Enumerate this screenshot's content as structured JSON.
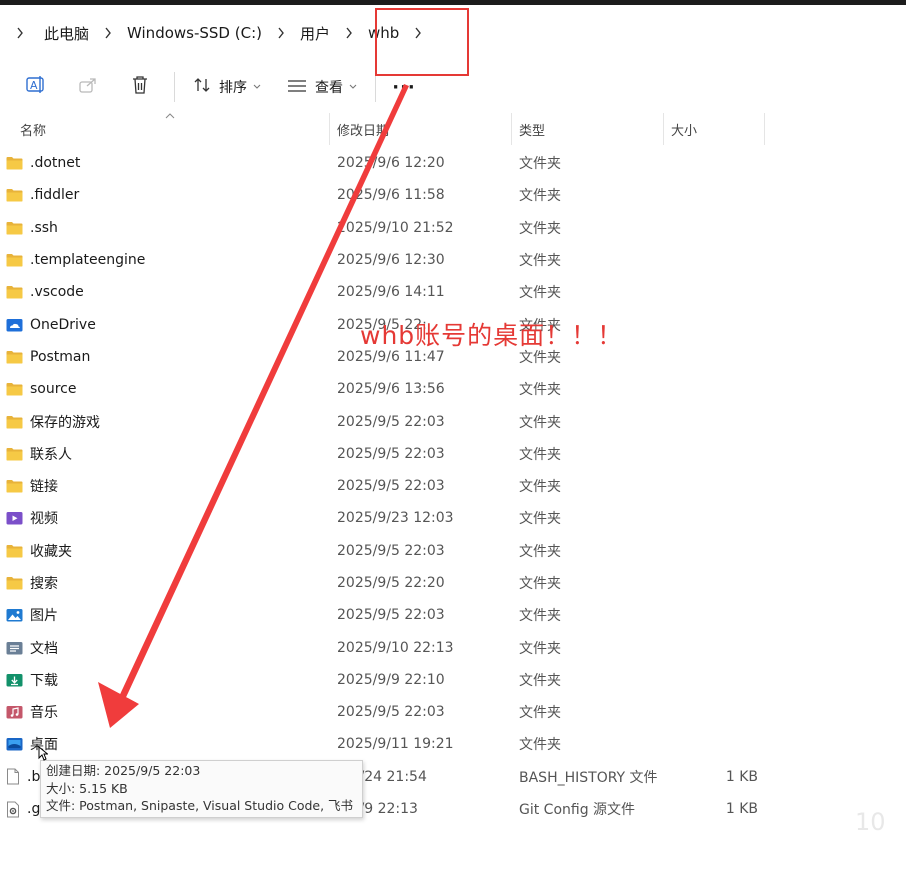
{
  "breadcrumb": {
    "items": [
      "此电脑",
      "Windows-SSD (C:)",
      "用户",
      "whb"
    ]
  },
  "toolbar": {
    "sort_label": "排序",
    "view_label": "查看",
    "more_label": "···"
  },
  "columns": {
    "name": "名称",
    "date": "修改日期",
    "type": "类型",
    "size": "大小"
  },
  "files": [
    {
      "name": ".dotnet",
      "date": "2025/9/6 12:20",
      "type": "文件夹",
      "size": "",
      "icon": "folder-icon"
    },
    {
      "name": ".fiddler",
      "date": "2025/9/6 11:58",
      "type": "文件夹",
      "size": "",
      "icon": "folder-icon"
    },
    {
      "name": ".ssh",
      "date": "2025/9/10 21:52",
      "type": "文件夹",
      "size": "",
      "icon": "folder-icon"
    },
    {
      "name": ".templateengine",
      "date": "2025/9/6 12:30",
      "type": "文件夹",
      "size": "",
      "icon": "folder-icon"
    },
    {
      "name": ".vscode",
      "date": "2025/9/6 14:11",
      "type": "文件夹",
      "size": "",
      "icon": "folder-icon"
    },
    {
      "name": "OneDrive",
      "date": "2025/9/5 22:",
      "type": "文件夹",
      "size": "",
      "icon": "onedrive-folder-icon"
    },
    {
      "name": "Postman",
      "date": "2025/9/6 11:47",
      "type": "文件夹",
      "size": "",
      "icon": "folder-icon"
    },
    {
      "name": "source",
      "date": "2025/9/6 13:56",
      "type": "文件夹",
      "size": "",
      "icon": "folder-icon"
    },
    {
      "name": "保存的游戏",
      "date": "2025/9/5 22:03",
      "type": "文件夹",
      "size": "",
      "icon": "folder-icon"
    },
    {
      "name": "联系人",
      "date": "2025/9/5 22:03",
      "type": "文件夹",
      "size": "",
      "icon": "folder-icon"
    },
    {
      "name": "链接",
      "date": "2025/9/5 22:03",
      "type": "文件夹",
      "size": "",
      "icon": "folder-icon"
    },
    {
      "name": "视频",
      "date": "2025/9/23 12:03",
      "type": "文件夹",
      "size": "",
      "icon": "videos-folder-icon"
    },
    {
      "name": "收藏夹",
      "date": "2025/9/5 22:03",
      "type": "文件夹",
      "size": "",
      "icon": "folder-icon"
    },
    {
      "name": "搜索",
      "date": "2025/9/5 22:20",
      "type": "文件夹",
      "size": "",
      "icon": "folder-icon"
    },
    {
      "name": "图片",
      "date": "2025/9/5 22:03",
      "type": "文件夹",
      "size": "",
      "icon": "pictures-folder-icon"
    },
    {
      "name": "文档",
      "date": "2025/9/10 22:13",
      "type": "文件夹",
      "size": "",
      "icon": "documents-folder-icon"
    },
    {
      "name": "下载",
      "date": "2025/9/9 22:10",
      "type": "文件夹",
      "size": "",
      "icon": "downloads-folder-icon"
    },
    {
      "name": "音乐",
      "date": "2025/9/5 22:03",
      "type": "文件夹",
      "size": "",
      "icon": "music-folder-icon"
    },
    {
      "name": "桌面",
      "date": "2025/9/11 19:21",
      "type": "文件夹",
      "size": "",
      "icon": "desktop-folder-icon",
      "selected": true
    },
    {
      "name": ".b",
      "date": "5/9/24 21:54",
      "type": "BASH_HISTORY 文件",
      "size": "1 KB",
      "icon": "file-icon"
    },
    {
      "name": ".g",
      "date": "5/9/9 22:13",
      "type": "Git Config 源文件",
      "size": "1 KB",
      "icon": "config-file-icon"
    }
  ],
  "tooltip": {
    "created": "创建日期: 2025/9/5 22:03",
    "size": "大小: 5.15 KB",
    "files": "文件: Postman, Snipaste, Visual Studio Code, 飞书"
  },
  "annotation": {
    "text": "whb账号的桌面！！！",
    "color": "#e53935"
  },
  "watermark": "10"
}
